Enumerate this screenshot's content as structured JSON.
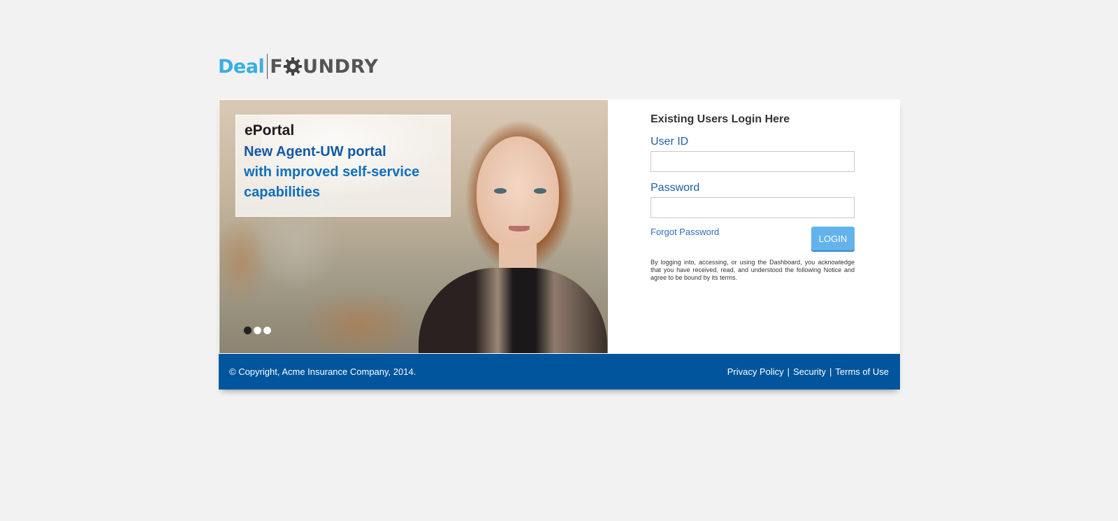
{
  "logo": {
    "part1": "Deal",
    "part2_before": "F",
    "part2_after": "UNDRY",
    "icon": "gear-icon"
  },
  "hero": {
    "title": "ePortal",
    "subtitle_line1": "New Agent-UW portal",
    "subtitle_rest": "with improved self-service capabilities",
    "slides": 3,
    "active_slide": 1
  },
  "login": {
    "heading": "Existing Users Login Here",
    "userid_label": "User ID",
    "userid_value": "",
    "password_label": "Password",
    "password_value": "",
    "forgot_label": "Forgot Password",
    "button_label": "LOGIN",
    "notice": "By logging into, accessing, or using the Dashboard, you acknowledge that you have received, read, and understood the following Notice and agree to be bound by its terms."
  },
  "footer": {
    "copyright": "© Copyright, Acme Insurance Company, 2014.",
    "links": [
      "Privacy Policy",
      "Security",
      "Terms of Use"
    ],
    "separator": "|"
  },
  "colors": {
    "accent": "#00559d",
    "button": "#64b2ec",
    "logo_blue": "#3aaee0"
  }
}
